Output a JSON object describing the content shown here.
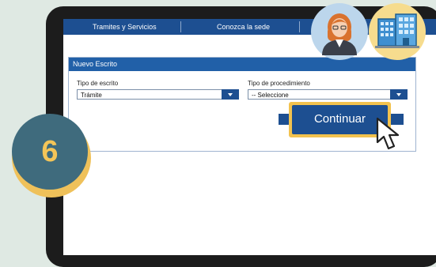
{
  "nav": {
    "items": [
      "Tramites y Servicios",
      "Conozca la sede"
    ]
  },
  "panel": {
    "title": "Nuevo Escrito",
    "field1": {
      "label": "Tipo de escrito",
      "value": "Trámite"
    },
    "field2": {
      "label": "Tipo de procedimiento",
      "value": "-- Seleccione"
    }
  },
  "button": {
    "label": "Continuar"
  },
  "step": {
    "number": "6"
  },
  "icons": [
    "woman-avatar-icon",
    "office-building-icon",
    "cursor-pointer-icon"
  ],
  "colors": {
    "accent": "#1d4f91",
    "highlight": "#f2c24e",
    "step_circle": "#3f6b7d"
  }
}
